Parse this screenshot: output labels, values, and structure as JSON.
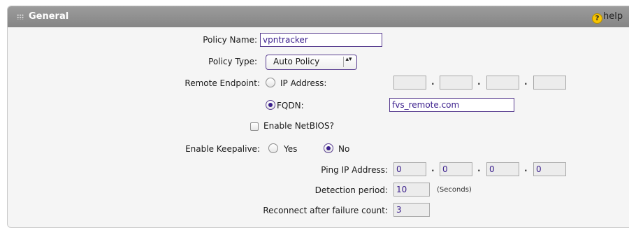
{
  "header": {
    "title": "General",
    "help": "help",
    "help_symbol": "?"
  },
  "policy_name": {
    "label": "Policy Name:",
    "value": "vpntracker"
  },
  "policy_type": {
    "label": "Policy Type:",
    "value": "Auto Policy",
    "arrows": "▴▾"
  },
  "remote_endpoint": {
    "label": "Remote Endpoint:",
    "ip_option": "IP Address:",
    "ip_values": [
      "",
      "",
      "",
      ""
    ],
    "fqdn_option": "FQDN:",
    "fqdn_value": "fvs_remote.com",
    "selected": "FQDN"
  },
  "netbios": {
    "label": "Enable NetBIOS?",
    "checked": false
  },
  "keepalive": {
    "label": "Enable Keepalive:",
    "yes": "Yes",
    "no": "No",
    "selected": "No"
  },
  "ping_ip": {
    "label": "Ping IP Address:",
    "values": [
      "0",
      "0",
      "0",
      "0"
    ]
  },
  "detection": {
    "label": "Detection period:",
    "value": "10",
    "unit": "(Seconds)"
  },
  "reconnect": {
    "label": "Reconnect after failure count:",
    "value": "3"
  },
  "ip_separator": ".",
  "colors": {
    "accent": "#3a1e8c",
    "header": "#8e8e8e",
    "help_icon": "#f7c400"
  }
}
